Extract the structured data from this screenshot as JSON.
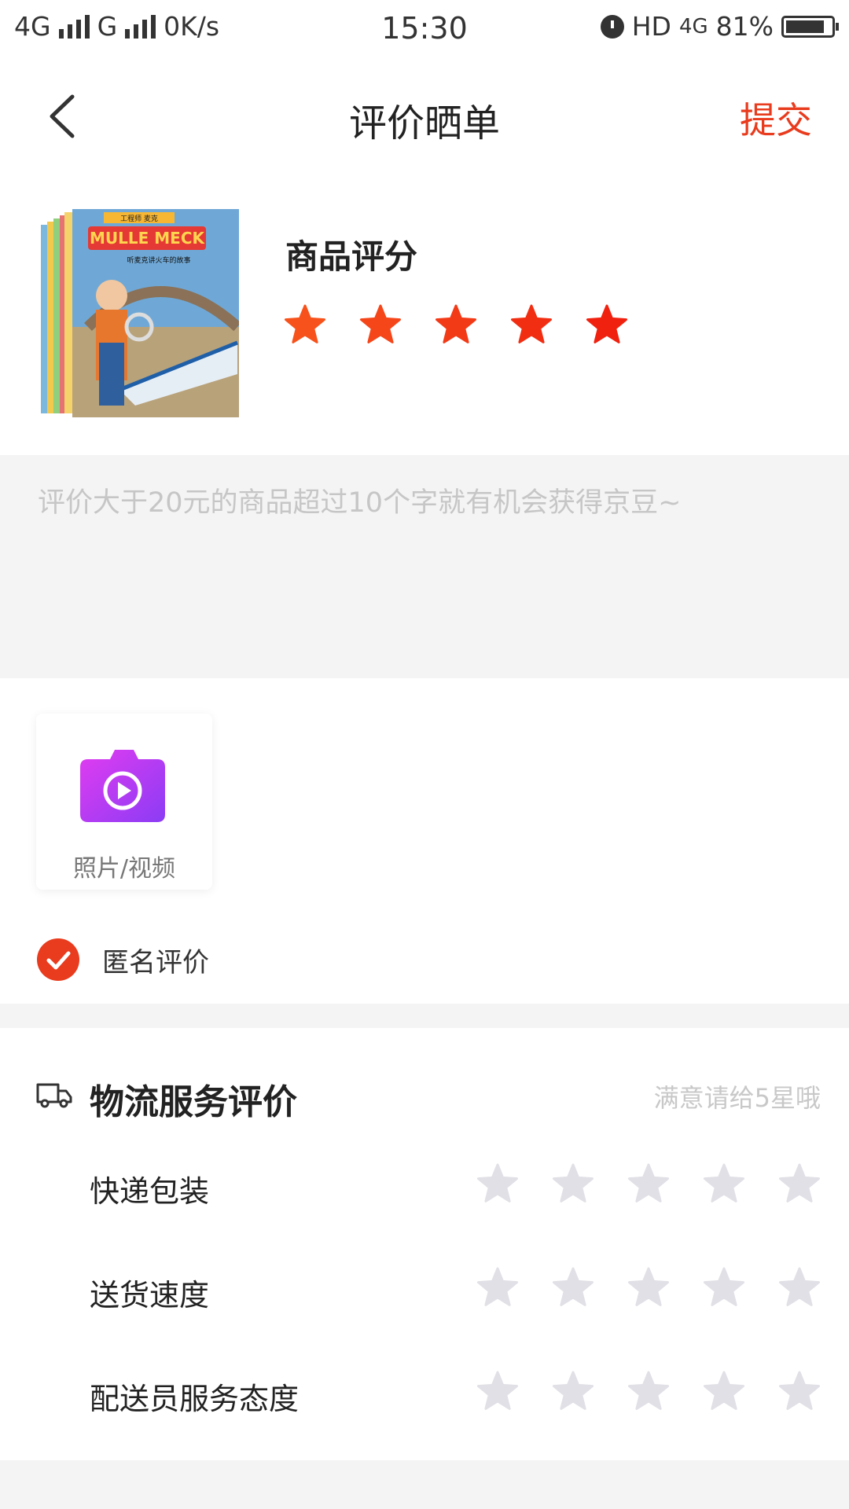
{
  "status_bar": {
    "network1": "4G",
    "network2": "G",
    "speed": "0K/s",
    "time": "15:30",
    "hd": "HD",
    "net3": "4G",
    "battery": "81%"
  },
  "nav": {
    "title": "评价晒单",
    "submit_label": "提交"
  },
  "product": {
    "rating_label": "商品评分",
    "rating": 5,
    "max_rating": 5,
    "cover_title": "MULLE MECK",
    "cover_subtitle": "听麦克讲火车的故事",
    "cover_series": "工程师 麦克"
  },
  "review": {
    "placeholder": "评价大于20元的商品超过10个字就有机会获得京豆~",
    "value": ""
  },
  "media": {
    "upload_label": "照片/视频",
    "anonymous_label": "匿名评价",
    "anonymous_checked": true
  },
  "logistics": {
    "title": "物流服务评价",
    "hint": "满意请给5星哦",
    "items": [
      {
        "label": "快递包装",
        "rating": 0
      },
      {
        "label": "送货速度",
        "rating": 0
      },
      {
        "label": "配送员服务态度",
        "rating": 0
      }
    ]
  },
  "colors": {
    "accent": "#e93b1d",
    "star_empty": "#e0e0e6",
    "star_filled": "#f23a14"
  }
}
